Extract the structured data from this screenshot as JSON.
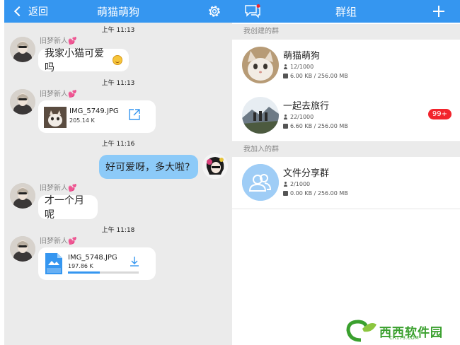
{
  "chat": {
    "back_label": "返回",
    "title": "萌猫萌狗",
    "settings_icon": "gear-icon",
    "messages": [
      {
        "time": "上午 11:13",
        "sender": "旧梦新人",
        "text": "我家小猫可爱吗"
      },
      {
        "time": "上午 11:13",
        "sender": "旧梦新人",
        "file_name": "IMG_5749.JPG",
        "file_size": "205.14 K",
        "action_icon": "open-external-icon"
      },
      {
        "time": "上午 11:16",
        "text": "好可爱呀，多大啦?"
      },
      {
        "sender": "旧梦新人",
        "text": "才一个月呢"
      },
      {
        "time": "上午 11:18",
        "sender": "旧梦新人",
        "file_name": "IMG_5748.JPG",
        "file_size": "197.86 K",
        "action_icon": "download-icon",
        "progress_percent": 45
      }
    ],
    "sender_heart": "💕"
  },
  "groups": {
    "title": "群组",
    "message_icon": "chat-bubbles-icon",
    "add_icon": "plus-icon",
    "created_label": "我创建的群",
    "joined_label": "我加入的群",
    "created": [
      {
        "name": "萌猫萌狗",
        "members": "12/1000",
        "storage": "6.00 KB / 256.00 MB"
      },
      {
        "name": "一起去旅行",
        "members": "22/1000",
        "storage": "6.60 KB / 256.00 MB",
        "badge": "99+"
      }
    ],
    "joined": [
      {
        "name": "文件分享群",
        "members": "2/1000",
        "storage": "0.00 KB / 256.00 MB"
      }
    ]
  },
  "colors": {
    "accent": "#3596f0",
    "chat_bg": "#ebebeb",
    "my_bubble": "#8ccaf8",
    "badge_red": "#f2242c",
    "watermark_green": "#3aa02e"
  },
  "watermark": {
    "text": "西西软件园",
    "sub": "CR173.COM"
  }
}
